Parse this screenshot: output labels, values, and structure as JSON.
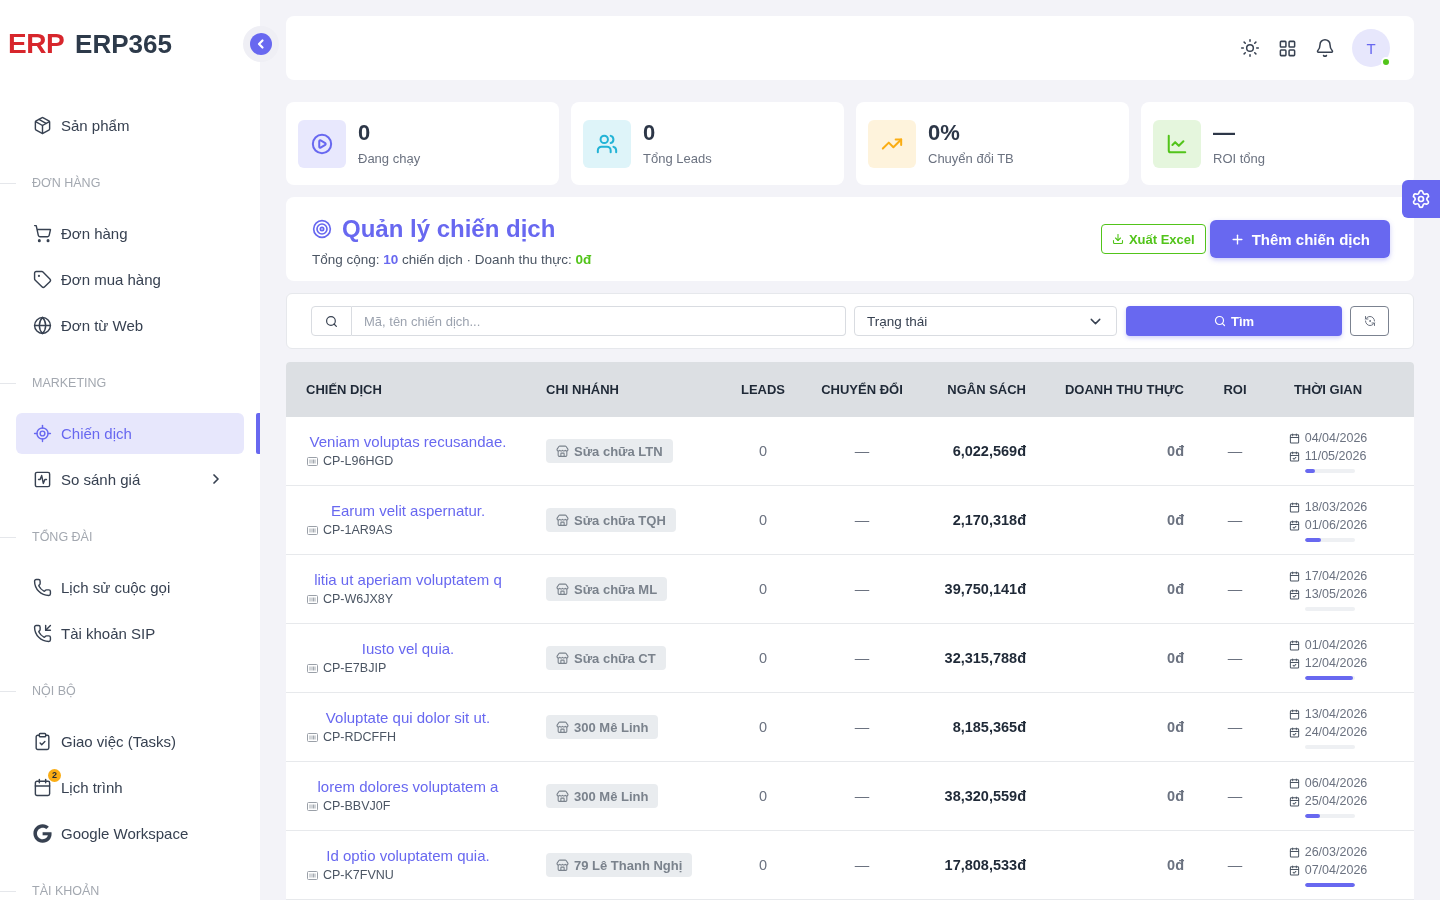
{
  "sidebar": {
    "logo": {
      "mark": "ERP",
      "name": "ERP365"
    },
    "sections": [
      {
        "items": [
          {
            "label": "Sản phẩm",
            "kind": "link",
            "selected": false
          }
        ]
      },
      {
        "title": "ĐƠN HÀNG",
        "items": [
          {
            "label": "Đơn hàng",
            "kind": "link",
            "selected": false
          },
          {
            "label": "Đơn mua hàng",
            "kind": "link",
            "selected": false
          },
          {
            "label": "Đơn từ Web",
            "kind": "link",
            "selected": false
          }
        ]
      },
      {
        "title": "MARKETING",
        "items": [
          {
            "label": "Chiến dịch",
            "kind": "link",
            "selected": true
          },
          {
            "label": "So sánh giá",
            "kind": "submenu",
            "selected": false
          }
        ]
      },
      {
        "title": "TỔNG ĐÀI",
        "items": [
          {
            "label": "Lịch sử cuộc gọi",
            "kind": "link",
            "selected": false
          },
          {
            "label": "Tài khoản SIP",
            "kind": "link",
            "selected": false
          }
        ]
      },
      {
        "title": "NỘI BỘ",
        "items": [
          {
            "label": "Giao việc (Tasks)",
            "kind": "link",
            "selected": false
          },
          {
            "label": "Lịch trình",
            "kind": "link",
            "selected": false,
            "badge": "2"
          },
          {
            "label": "Google Workspace",
            "kind": "link",
            "selected": false
          }
        ]
      },
      {
        "title": "TÀI KHOẢN"
      }
    ]
  },
  "topbar": {
    "avatar": {
      "initial": "T",
      "online": true
    }
  },
  "stats": [
    {
      "value": "0",
      "label": "Đang chạy",
      "color": "#6868f0"
    },
    {
      "value": "0",
      "label": "Tổng Leads",
      "color": "#22b3d6"
    },
    {
      "value": "0%",
      "label": "Chuyển đổi TB",
      "color": "#faad14"
    },
    {
      "value": "—",
      "label": "ROI tổng",
      "color": "#52c41a"
    }
  ],
  "header": {
    "title": "Quản lý chiến dịch",
    "summary": "Tổng cộng: **10** chiến dịch · Doanh thu thực: **0đ**",
    "buttons": [
      {
        "label": "Xuất Excel",
        "kind": "outline"
      },
      {
        "label": "Thêm chiến dịch",
        "kind": "primary"
      }
    ]
  },
  "filters": {
    "search": {
      "placeholder": "Mã, tên chiến dịch..."
    },
    "status": {
      "value": "Trạng thái"
    },
    "search_button": "Tìm"
  },
  "table": {
    "columns": [
      "CHIẾN DỊCH",
      "CHI NHÁNH",
      "LEADS",
      "CHUYỂN ĐỔI",
      "NGÂN SÁCH",
      "DOANH THU THỰC",
      "ROI",
      "THỜI GIAN"
    ],
    "rows": [
      {
        "name": "Veniam voluptas recusandae.",
        "code": "CP-L96HGD",
        "branch": "Sửa chữa LTN",
        "leads": "0",
        "conversion": "—",
        "budget": "6,022,569đ",
        "revenue": "0đ",
        "roi": "—",
        "start": "04/04/2026",
        "end": "11/05/2026",
        "level": 0.2
      },
      {
        "name": "Earum velit aspernatur.",
        "code": "CP-1AR9AS",
        "branch": "Sửa chữa TQH",
        "leads": "0",
        "conversion": "—",
        "budget": "2,170,318đ",
        "revenue": "0đ",
        "roi": "—",
        "start": "18/03/2026",
        "end": "01/06/2026",
        "level": 0.32
      },
      {
        "name": "litia ut aperiam voluptatem q",
        "code": "CP-W6JX8Y",
        "branch": "Sửa chữa ML",
        "leads": "0",
        "conversion": "—",
        "budget": "39,750,141đ",
        "revenue": "0đ",
        "roi": "—",
        "start": "17/04/2026",
        "end": "13/05/2026",
        "level": 0
      },
      {
        "name": "Iusto vel quia.",
        "code": "CP-E7BJIP",
        "branch": "Sửa chữa CT",
        "leads": "0",
        "conversion": "—",
        "budget": "32,315,788đ",
        "revenue": "0đ",
        "roi": "—",
        "start": "01/04/2026",
        "end": "12/04/2026",
        "level": 0.96
      },
      {
        "name": "Voluptate qui dolor sit ut.",
        "code": "CP-RDCFFH",
        "branch": "300 Mê Linh",
        "leads": "0",
        "conversion": "—",
        "budget": "8,185,365đ",
        "revenue": "0đ",
        "roi": "—",
        "start": "13/04/2026",
        "end": "24/04/2026",
        "level": 0
      },
      {
        "name": "lorem dolores voluptatem a",
        "code": "CP-BBVJ0F",
        "branch": "300 Mê Linh",
        "leads": "0",
        "conversion": "—",
        "budget": "38,320,559đ",
        "revenue": "0đ",
        "roi": "—",
        "start": "06/04/2026",
        "end": "25/04/2026",
        "level": 0.3
      },
      {
        "name": "Id optio voluptatem quia.",
        "code": "CP-K7FVNU",
        "branch": "79 Lê Thanh Nghị",
        "leads": "0",
        "conversion": "—",
        "budget": "17,808,533đ",
        "revenue": "0đ",
        "roi": "—",
        "start": "26/03/2026",
        "end": "07/04/2026",
        "level": 1
      }
    ]
  }
}
